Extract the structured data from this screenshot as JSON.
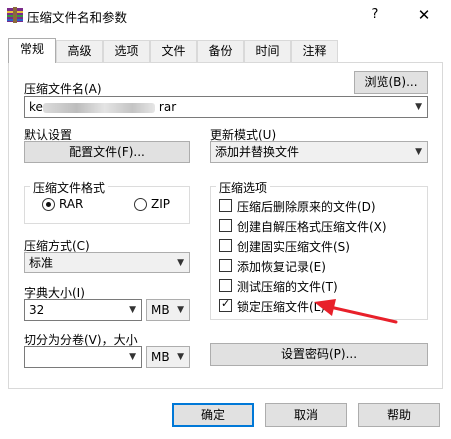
{
  "window": {
    "title": "压缩文件名和参数",
    "help_glyph": "?",
    "close_glyph": "✕"
  },
  "tabs": [
    {
      "label": "常规",
      "active": true
    },
    {
      "label": "高级"
    },
    {
      "label": "选项"
    },
    {
      "label": "文件"
    },
    {
      "label": "备份"
    },
    {
      "label": "时间"
    },
    {
      "label": "注释"
    }
  ],
  "archive_name": {
    "label": "压缩文件名(A)",
    "browse_label": "浏览(B)...",
    "prefix": "ke",
    "suffix": "rar"
  },
  "profiles": {
    "label": "默认设置",
    "button_label": "配置文件(F)..."
  },
  "update_mode": {
    "label": "更新模式(U)",
    "value": "添加并替换文件"
  },
  "format": {
    "label": "压缩文件格式",
    "options": [
      {
        "label": "RAR",
        "selected": true
      },
      {
        "label": "ZIP",
        "selected": false
      }
    ]
  },
  "method": {
    "label": "压缩方式(C)",
    "value": "标准"
  },
  "dictionary": {
    "label": "字典大小(I)",
    "value": "32",
    "unit": "MB"
  },
  "split": {
    "label": "切分为分卷(V)，大小",
    "value": "",
    "unit": "MB"
  },
  "options": {
    "label": "压缩选项",
    "items": [
      {
        "label": "压缩后删除原来的文件(D)",
        "checked": false
      },
      {
        "label": "创建自解压格式压缩文件(X)",
        "checked": false
      },
      {
        "label": "创建固实压缩文件(S)",
        "checked": false
      },
      {
        "label": "添加恢复记录(E)",
        "checked": false
      },
      {
        "label": "测试压缩的文件(T)",
        "checked": false
      },
      {
        "label": "锁定压缩文件(L)",
        "checked": true
      }
    ]
  },
  "password_button": "设置密码(P)...",
  "footer": {
    "ok": "确定",
    "cancel": "取消",
    "help": "帮助"
  },
  "colors": {
    "accent": "#0078d7",
    "arrow": "#e8202a",
    "dialog_bg": "#ffffff",
    "button_bg": "#e1e1e1"
  }
}
